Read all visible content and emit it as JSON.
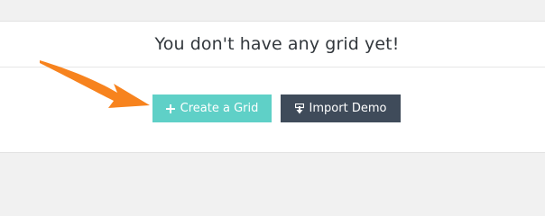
{
  "panel": {
    "title": "You don't have any grid yet!"
  },
  "actions": {
    "create_label": "Create a Grid",
    "create_icon": "plus-icon",
    "import_label": "Import Demo",
    "import_icon": "import-icon"
  },
  "annotation": {
    "arrow_icon": "orange-arrow-icon",
    "arrow_color": "#f7831e"
  },
  "colors": {
    "create_button": "#5fd0c7",
    "import_button": "#3f4b5a",
    "background": "#f1f1f1",
    "panel": "#ffffff",
    "title_text": "#32373c"
  }
}
